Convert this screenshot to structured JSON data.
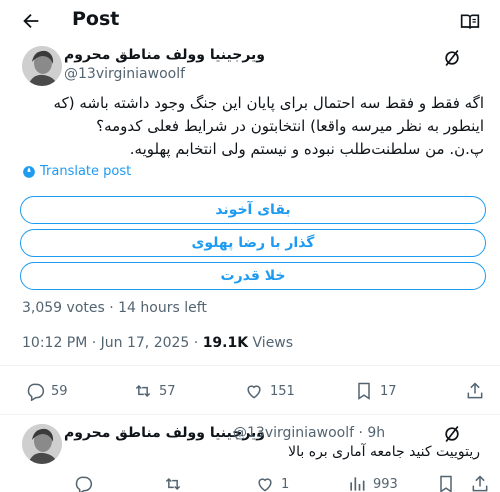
{
  "header": {
    "title": "Post",
    "back_icon": "arrow-left-icon",
    "reader_icon": "open-book-icon"
  },
  "post": {
    "author_name": "ویرجینیا وولف مناطق محروم",
    "author_handle": "@13virginiawoolf",
    "text_lines": [
      "اگه فقط و فقط سه احتمال برای پایان این جنگ وجود داشته باشه (که",
      "اینطور به نظر میرسه واقعا) انتخابتون در شرایط فعلی کدومه؟",
      "پ.ن. من سلطنت‌طلب نبوده و نیستم ولی انتخابم پهلویه."
    ],
    "translate_label": "Translate post",
    "poll_options": [
      "بقای آخوند",
      "گذار با رضا پهلوی",
      "خلا قدرت"
    ],
    "poll_meta": "3,059 votes · 14 hours left",
    "time": "10:12 PM · Jun 17, 2025 · ",
    "views_count": "19.1K",
    "views_label": " Views",
    "stats": {
      "replies": "59",
      "reposts": "57",
      "likes": "151",
      "bookmarks": "17"
    }
  },
  "reply": {
    "author_name": "ویرجینیا وولف مناطق محروم",
    "handle_time": "@13virginiawoolf · 9h",
    "text": "ریتوییت کنید جامعه آماری بره بالا",
    "stats": {
      "likes": "1",
      "views": "993"
    }
  },
  "colors": {
    "accent": "#1d9bf0",
    "muted": "#536471",
    "text": "#0f1419"
  }
}
